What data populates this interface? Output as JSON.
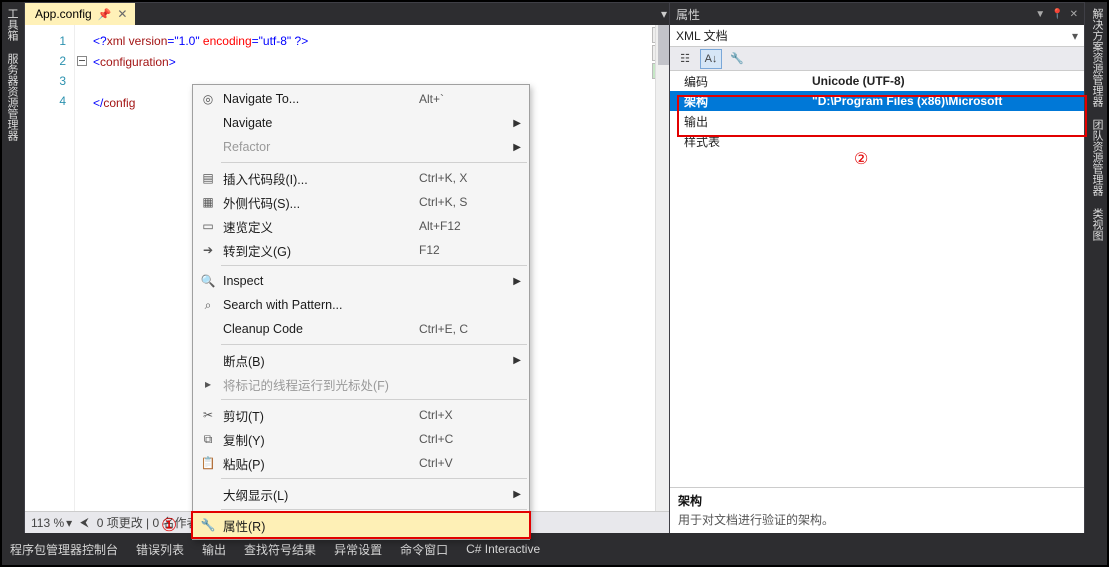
{
  "left_tabs": [
    "工具箱",
    "服务器资源管理器"
  ],
  "right_tabs": [
    "解决方案资源管理器",
    "团队资源管理器",
    "类视图"
  ],
  "editor": {
    "tab_label": "App.config",
    "line_numbers": [
      "1",
      "2",
      "3",
      "4"
    ],
    "line1_a": "<?",
    "line1_b": "xml version",
    "line1_c": "=\"1.0\"",
    "line1_d": " encoding",
    "line1_e": "=\"utf-8\"",
    "line1_f": " ?>",
    "line2_a": "<",
    "line2_b": "configuration",
    "line2_c": ">",
    "line4_a": "</",
    "line4_b": "config",
    "line4_c": "",
    "zoom": "113 %",
    "status_text": "0 项更改 | 0 名作者，0 项更改"
  },
  "context_menu": {
    "items": [
      {
        "icon": "target-icon",
        "label": "Navigate To...",
        "shortcut": "Alt+`",
        "arrow": false,
        "disabled": false
      },
      {
        "label": "Navigate",
        "arrow": true
      },
      {
        "label": "Refactor",
        "arrow": true,
        "disabled": true
      },
      {
        "sep": true
      },
      {
        "icon": "snippet-icon",
        "label": "插入代码段(I)...",
        "shortcut": "Ctrl+K, X"
      },
      {
        "icon": "snippet-out-icon",
        "label": "外侧代码(S)...",
        "shortcut": "Ctrl+K, S"
      },
      {
        "icon": "book-icon",
        "label": "速览定义",
        "shortcut": "Alt+F12"
      },
      {
        "icon": "goto-icon",
        "label": "转到定义(G)",
        "shortcut": "F12"
      },
      {
        "sep": true
      },
      {
        "icon": "inspect-icon",
        "label": "Inspect",
        "arrow": true
      },
      {
        "icon": "search-icon",
        "label": "Search with Pattern..."
      },
      {
        "label": "Cleanup Code",
        "shortcut": "Ctrl+E, C"
      },
      {
        "sep": true
      },
      {
        "label": "断点(B)",
        "arrow": true
      },
      {
        "icon": "run-to-icon",
        "label": "将标记的线程运行到光标处(F)",
        "disabled": true
      },
      {
        "sep": true
      },
      {
        "icon": "cut-icon",
        "label": "剪切(T)",
        "shortcut": "Ctrl+X"
      },
      {
        "icon": "copy-icon",
        "label": "复制(Y)",
        "shortcut": "Ctrl+C"
      },
      {
        "icon": "paste-icon",
        "label": "粘贴(P)",
        "shortcut": "Ctrl+V"
      },
      {
        "sep": true
      },
      {
        "label": "大纲显示(L)",
        "arrow": true
      },
      {
        "sep": true
      },
      {
        "icon": "wrench-icon",
        "label": "属性(R)",
        "highlight": true
      }
    ]
  },
  "properties": {
    "title": "属性",
    "subtitle": "XML 文档",
    "rows": [
      {
        "k": "编码",
        "v": "Unicode (UTF-8)"
      },
      {
        "k": "架构",
        "v": "\"D:\\Program Files (x86)\\Microsoft",
        "selected": true
      },
      {
        "k": "输出",
        "v": ""
      },
      {
        "k": "样式表",
        "v": ""
      }
    ],
    "desc_title": "架构",
    "desc_text": "用于对文档进行验证的架构。"
  },
  "bottom_tabs": [
    "程序包管理器控制台",
    "错误列表",
    "输出",
    "查找符号结果",
    "异常设置",
    "命令窗口",
    "C# Interactive"
  ],
  "annotations": {
    "one": "①",
    "two": "②"
  }
}
